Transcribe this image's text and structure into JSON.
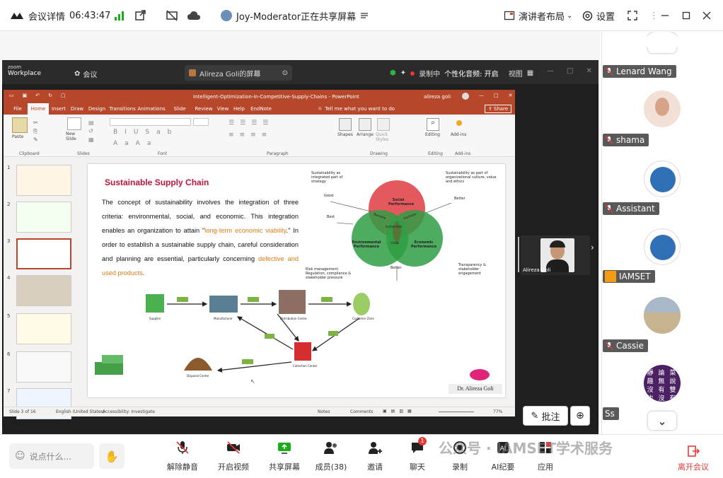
{
  "topbar": {
    "meeting_details": "会议详情",
    "time": "06:43:47",
    "sharing_status": "Joy-Moderator正在共享屏幕",
    "presenter_layout": "演讲者布局",
    "settings": "设置"
  },
  "zoom_window": {
    "brand_line1": "zoom",
    "brand_line2": "Workplace",
    "meeting_label": "会议",
    "screen_title": "Alireza Goli的屏幕",
    "recording": "录制中",
    "personalized_audio": "个性化音频: 开启",
    "view": "视图"
  },
  "ppt": {
    "title": "Intelligent-Optimization-in-Competitive-Supply-Chains - PowerPoint",
    "user": "alireza goli",
    "tabs": [
      "File",
      "Home",
      "Insert",
      "Draw",
      "Design",
      "Transitions",
      "Animations",
      "Slide Show",
      "Review",
      "View",
      "Help",
      "EndNote 20"
    ],
    "tell_me": "Tell me what you want to do",
    "share": "Share",
    "ribbon_groups": [
      "Clipboard",
      "Slides",
      "Font",
      "Paragraph",
      "Drawing",
      "Editing",
      "Add-ins"
    ],
    "ribbon_buttons": {
      "paste": "Paste",
      "new_slide": "New Slide",
      "shapes": "Shapes",
      "arrange": "Arrange",
      "quick_styles": "Quick Styles",
      "editing": "Editing",
      "addins": "Add-ins"
    },
    "thumb_numbers": [
      "1",
      "2",
      "3",
      "4",
      "5",
      "6",
      "7"
    ],
    "status_slide": "Slide 3 of 16",
    "status_lang": "English (United States)",
    "status_access": "Accessibility: Investigate",
    "status_notes": "Notes",
    "status_comments": "Comments",
    "zoom": "77%"
  },
  "slide": {
    "title": "Sustainable Supply Chain",
    "body_1": "The concept of sustainability involves the integration of three criteria: environmental, social, and economic. This integration enables an organization to attain \"",
    "body_highlight_1": "long-term economic viability",
    "body_2": ".\" In order to establish a sustainable supply chain, careful consideration and planning are essential, particularly concerning ",
    "body_highlight_2": "defective and used products",
    "body_3": ".",
    "venn": {
      "social": "Social Performance",
      "environmental": "Environmental Performance",
      "economic": "Economic Performance",
      "bearable": "Bearable",
      "equitable": "Equitable",
      "viable": "Viable",
      "sustainable": "Sustainable",
      "note_left": "Sustainability as integrated part of strategy",
      "note_right": "Sustainability as part of organizational culture, value and ethics",
      "good": "Good",
      "best": "Best",
      "better_top": "Better",
      "better_bottom": "Better",
      "risk": "Risk management: Regulation, compliance & stakeholder pressure",
      "transparency": "Transparency & stakeholder engagement"
    },
    "flow": {
      "supplier": "Supplier",
      "manufacturer": "Manufacturer",
      "distribution": "Distribution Center",
      "customer": "Customer Zone",
      "collection": "Collection Center",
      "disposal": "Disposal Center"
    },
    "author": "Dr. Alireza Goli"
  },
  "video_tile": {
    "name": "Alireza Goli"
  },
  "annotate_button": "批注",
  "participants": [
    {
      "name": "Lenard Wang",
      "muted": true
    },
    {
      "name": "shama",
      "muted": true
    },
    {
      "name": "Assistant",
      "muted": true
    },
    {
      "name": "IAMSET",
      "muted": false
    },
    {
      "name": "Cassie",
      "muted": true
    },
    {
      "name": "Ss",
      "muted": false
    }
  ],
  "avatar_ss_text": "靜 論 菜 趣 無 說 沒 有 雙 也 沒 有",
  "bottombar": {
    "chat_placeholder": "说点什么...",
    "buttons": [
      {
        "label": "解除静音",
        "icon": "mic-muted-icon"
      },
      {
        "label": "开启视频",
        "icon": "video-off-icon"
      },
      {
        "label": "共享屏幕",
        "icon": "share-screen-icon"
      },
      {
        "label": "成员(38)",
        "icon": "members-icon"
      },
      {
        "label": "邀请",
        "icon": "invite-icon"
      },
      {
        "label": "聊天",
        "icon": "chat-icon",
        "badge": "1"
      },
      {
        "label": "录制",
        "icon": "record-icon"
      },
      {
        "label": "AI纪要",
        "icon": "ai-summary-icon"
      },
      {
        "label": "应用",
        "icon": "apps-icon"
      }
    ],
    "leave": "离开会议"
  },
  "watermark": "公众号 · IAMSET学术服务"
}
